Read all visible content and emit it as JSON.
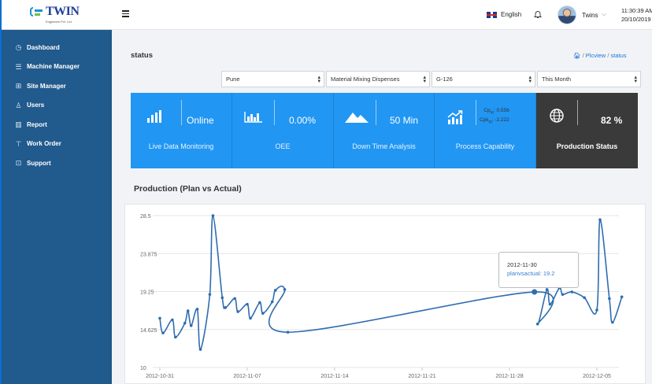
{
  "header": {
    "language": "English",
    "user_name": "Twins",
    "time": "11:30:39 AM",
    "date": "20/10/2019"
  },
  "brand": {
    "name": "TWIN",
    "tagline": "Engineers Pvt. Ltd."
  },
  "sidebar": {
    "items": [
      {
        "label": "Dashboard",
        "icon": "dashboard-icon"
      },
      {
        "label": "Machine Manager",
        "icon": "list-icon"
      },
      {
        "label": "Site Manager",
        "icon": "grid-icon"
      },
      {
        "label": "Users",
        "icon": "user-icon"
      },
      {
        "label": "Report",
        "icon": "bar-chart-icon"
      },
      {
        "label": "Work Order",
        "icon": "pin-icon"
      },
      {
        "label": "Support",
        "icon": "support-icon"
      }
    ]
  },
  "page": {
    "title": "status",
    "breadcrumb": [
      "Plcview",
      "status"
    ]
  },
  "filters": {
    "location": "Pune",
    "machine": "Material Mixing Dispenses",
    "model": "G-126",
    "period": "This Month"
  },
  "tiles": [
    {
      "value": "Online",
      "caption": "Live Data Monitoring",
      "icon": "signal-bars-icon"
    },
    {
      "value": "0.00%",
      "caption": "OEE",
      "icon": "column-chart-icon"
    },
    {
      "value": "50 Min",
      "caption": "Down Time Analysis",
      "icon": "mountain-icon"
    },
    {
      "cp": "Cp",
      "cp_sub": "m",
      "cp_value": ": 0.556",
      "cpk": "Cpk",
      "cpk_sub": "m",
      "cpk_value": ": -2.222",
      "caption": "Process Capability",
      "icon": "growth-chart-icon"
    },
    {
      "value": "82 %",
      "caption": "Production Status",
      "icon": "globe-icon"
    }
  ],
  "section": {
    "title": "Production (Plan vs Actual)"
  },
  "colors": {
    "sidebar": "#215a8c",
    "tile": "#2196f3",
    "tile_dark": "#3a3a3a",
    "line": "#2f6db0"
  },
  "chart_data": {
    "type": "line",
    "series": [
      {
        "name": "planvsactual",
        "points": [
          [
            "2012-10-31",
            16.0
          ],
          [
            "2012-10-31",
            14.2
          ],
          [
            "2012-11-01",
            15.8
          ],
          [
            "2012-11-01",
            13.7
          ],
          [
            "2012-11-02",
            15.4
          ],
          [
            "2012-11-02",
            16.9
          ],
          [
            "2012-11-02",
            15.1
          ],
          [
            "2012-11-03",
            17.1
          ],
          [
            "2012-11-03",
            12.2
          ],
          [
            "2012-11-04",
            18.9
          ],
          [
            "2012-11-04",
            28.5
          ],
          [
            "2012-11-05",
            18.5
          ],
          [
            "2012-11-05",
            17.3
          ],
          [
            "2012-11-06",
            18.4
          ],
          [
            "2012-11-06",
            16.8
          ],
          [
            "2012-11-07",
            17.7
          ],
          [
            "2012-11-07",
            16.0
          ],
          [
            "2012-11-08",
            17.9
          ],
          [
            "2012-11-08",
            16.6
          ],
          [
            "2012-11-09",
            18.0
          ],
          [
            "2012-11-09",
            19.4
          ],
          [
            "2012-11-10",
            19.5
          ],
          [
            "2012-11-10",
            14.3
          ],
          [
            "2012-11-30",
            19.2
          ],
          [
            "2012-11-30",
            15.3
          ],
          [
            "2012-12-01",
            19.5
          ],
          [
            "2012-12-01",
            17.7
          ],
          [
            "2012-12-02",
            19.7
          ],
          [
            "2012-12-02",
            18.9
          ],
          [
            "2012-12-03",
            19.2
          ],
          [
            "2012-12-04",
            18.5
          ],
          [
            "2012-12-05",
            17.0
          ],
          [
            "2012-12-05",
            28.0
          ],
          [
            "2012-12-06",
            18.4
          ],
          [
            "2012-12-06",
            15.5
          ],
          [
            "2012-12-07",
            18.6
          ]
        ]
      }
    ],
    "y_ticks": [
      "28.5",
      "23.875",
      "19.25",
      "14.625",
      "10"
    ],
    "x_ticks": [
      "2012-10-31",
      "2012-11-07",
      "2012-11-14",
      "2012-11-21",
      "2012-11-28",
      "2012-12-05"
    ],
    "ylim": [
      10,
      28.5
    ],
    "grid": true,
    "tooltip": {
      "date": "2012-11-30",
      "label": "planvsactual: 19.2"
    }
  }
}
